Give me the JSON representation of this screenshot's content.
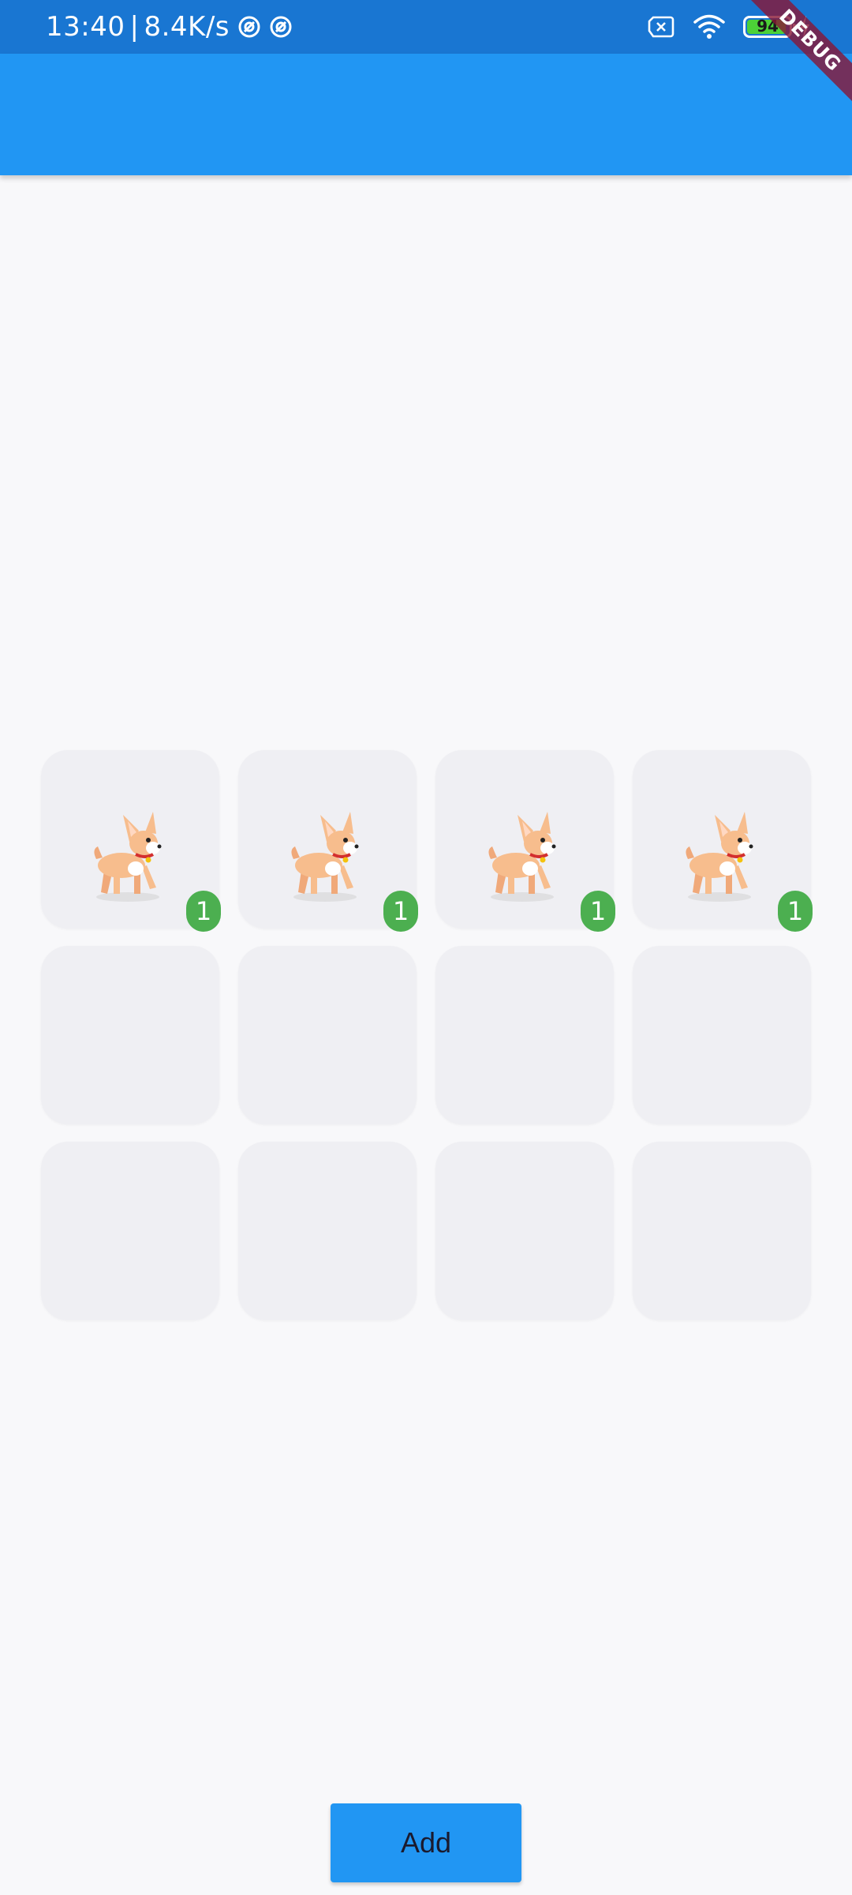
{
  "status_bar": {
    "time": "13:40",
    "separator": "|",
    "net_speed": "8.4K/s",
    "battery_level": "94",
    "battery_fraction": 0.94,
    "icons": [
      "at-icon",
      "at-icon",
      "sim-error-icon",
      "wifi-icon",
      "battery-icon",
      "charging-icon"
    ]
  },
  "debug_banner": "DEBUG",
  "colors": {
    "status_bar": "#1976d2",
    "app_bar": "#2196f3",
    "background": "#f8f8fa",
    "cell": "#efeff3",
    "badge": "#4caf50",
    "button": "#2196f3"
  },
  "grid": {
    "columns": 4,
    "rows": 3,
    "cells": [
      {
        "item": "chihuahua-dog",
        "count": "1"
      },
      {
        "item": "chihuahua-dog",
        "count": "1"
      },
      {
        "item": "chihuahua-dog",
        "count": "1"
      },
      {
        "item": "chihuahua-dog",
        "count": "1"
      },
      {
        "item": null,
        "count": null
      },
      {
        "item": null,
        "count": null
      },
      {
        "item": null,
        "count": null
      },
      {
        "item": null,
        "count": null
      },
      {
        "item": null,
        "count": null
      },
      {
        "item": null,
        "count": null
      },
      {
        "item": null,
        "count": null
      },
      {
        "item": null,
        "count": null
      }
    ]
  },
  "add_button": {
    "label": "Add"
  }
}
